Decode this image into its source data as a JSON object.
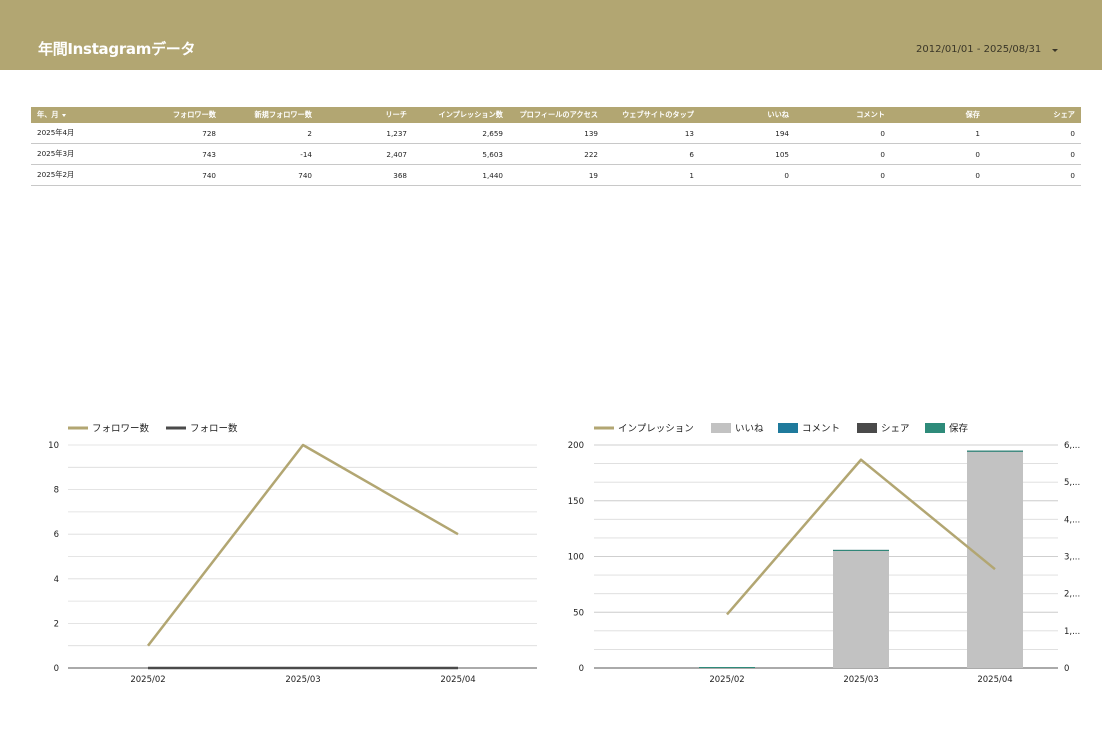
{
  "header": {
    "title": "年間Instagramデータ",
    "date_range": "2012/01/01 - 2025/08/31",
    "background": "#b2a672"
  },
  "table": {
    "columns": [
      "年、月",
      "フォロワー数",
      "新規フォロワー数",
      "リーチ",
      "インプレッション数",
      "プロフィールのアクセス",
      "ウェブサイトのタップ",
      "いいね",
      "コメント",
      "保存",
      "シェア"
    ],
    "sort_indicator": "descending",
    "rows": [
      [
        "2025年4月",
        "728",
        "2",
        "1,237",
        "2,659",
        "139",
        "13",
        "194",
        "0",
        "1",
        "0"
      ],
      [
        "2025年3月",
        "743",
        "-14",
        "2,407",
        "5,603",
        "222",
        "6",
        "105",
        "0",
        "0",
        "0"
      ],
      [
        "2025年2月",
        "740",
        "740",
        "368",
        "1,440",
        "19",
        "1",
        "0",
        "0",
        "0",
        "0"
      ]
    ]
  },
  "chart_data": [
    {
      "type": "line",
      "categories": [
        "2025/02",
        "2025/03",
        "2025/04"
      ],
      "series": [
        {
          "name": "フォロワー数",
          "values": [
            1,
            10,
            6
          ],
          "color": "#b2a672"
        },
        {
          "name": "フォロー数",
          "values": [
            0,
            0,
            0
          ],
          "color": "#4a4a4a"
        }
      ],
      "y_ticks": [
        "0",
        "2",
        "4",
        "6",
        "8",
        "10"
      ],
      "ylim": [
        0,
        10
      ],
      "grid": true,
      "legend_position": "top-left"
    },
    {
      "type": "bar",
      "categories": [
        "2025/02",
        "2025/03",
        "2025/04"
      ],
      "series": [
        {
          "name": "インプレッション",
          "kind": "line",
          "axis": "right",
          "values": [
            1440,
            5603,
            2659
          ],
          "color": "#b2a672"
        },
        {
          "name": "いいね",
          "kind": "bar",
          "axis": "left",
          "values": [
            0,
            105,
            194
          ],
          "color": "#c2c2c2"
        },
        {
          "name": "コメント",
          "kind": "bar",
          "axis": "left",
          "values": [
            0,
            0,
            0
          ],
          "color": "#1f7a9c"
        },
        {
          "name": "シェア",
          "kind": "bar",
          "axis": "left",
          "values": [
            0,
            0,
            0
          ],
          "color": "#4a4a4a"
        },
        {
          "name": "保存",
          "kind": "bar",
          "axis": "left",
          "values": [
            0,
            0,
            1
          ],
          "color": "#2e8b7a"
        }
      ],
      "y_ticks_left": [
        "0",
        "50",
        "100",
        "150",
        "200"
      ],
      "ylim_left": [
        0,
        200
      ],
      "y_ticks_right": [
        "0",
        "1,...",
        "2,...",
        "3,...",
        "4,...",
        "5,...",
        "6,..."
      ],
      "ylim_right": [
        0,
        6000
      ],
      "grid": true,
      "legend_position": "top-left"
    }
  ]
}
